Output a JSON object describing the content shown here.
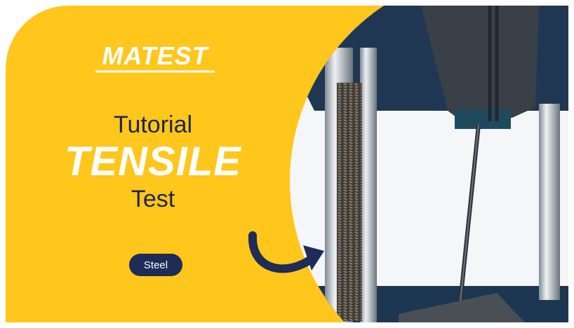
{
  "brand": {
    "logo_text": "MATEST"
  },
  "title": {
    "line1": "Tutorial",
    "line2": "TENSILE",
    "line3": "Test"
  },
  "tag": {
    "label": "Steel"
  },
  "icons": {
    "arrow": "curved-arrow-icon"
  },
  "colors": {
    "background": "#ffc61c",
    "navy": "#1e2c57",
    "white": "#ffffff"
  }
}
